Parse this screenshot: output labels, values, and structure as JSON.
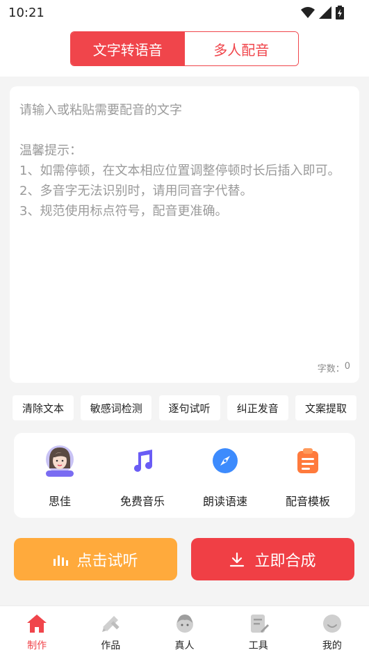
{
  "status_bar": {
    "time": "10:21"
  },
  "header_tabs": [
    {
      "label": "文字转语音",
      "active": true
    },
    {
      "label": "多人配音",
      "active": false
    }
  ],
  "editor": {
    "placeholder": "请输入或粘贴需要配音的文字\n\n温馨提示：\n1、如需停顿，在文本相应位置调整停顿时长后插入即可。\n2、多音字无法识别时，请用同音字代替。\n3、规范使用标点符号，配音更准确。",
    "char_count_label": "字数：",
    "char_count": "0"
  },
  "tools": [
    "清除文本",
    "敏感词检测",
    "逐句试听",
    "纠正发音",
    "文案提取"
  ],
  "features": [
    {
      "label": "思佳",
      "icon": "avatar-icon",
      "badge": "普通主播"
    },
    {
      "label": "免费音乐",
      "icon": "music-note-icon"
    },
    {
      "label": "朗读语速",
      "icon": "compass-icon"
    },
    {
      "label": "配音模板",
      "icon": "clipboard-icon"
    }
  ],
  "actions": {
    "preview": "点击试听",
    "synthesize": "立即合成"
  },
  "tabbar": [
    {
      "label": "制作",
      "icon": "home-icon",
      "active": true
    },
    {
      "label": "作品",
      "icon": "pencil-ruler-icon",
      "active": false
    },
    {
      "label": "真人",
      "icon": "person-icon",
      "active": false
    },
    {
      "label": "工具",
      "icon": "document-edit-icon",
      "active": false
    },
    {
      "label": "我的",
      "icon": "smile-icon",
      "active": false
    }
  ],
  "colors": {
    "accent_red": "#f0454b",
    "accent_orange": "#ffaa3c",
    "icon_purple": "#6a5cf5",
    "icon_blue": "#3d8bfd",
    "icon_orange": "#ff7a3c",
    "inactive_icon": "#cfcfcf"
  }
}
